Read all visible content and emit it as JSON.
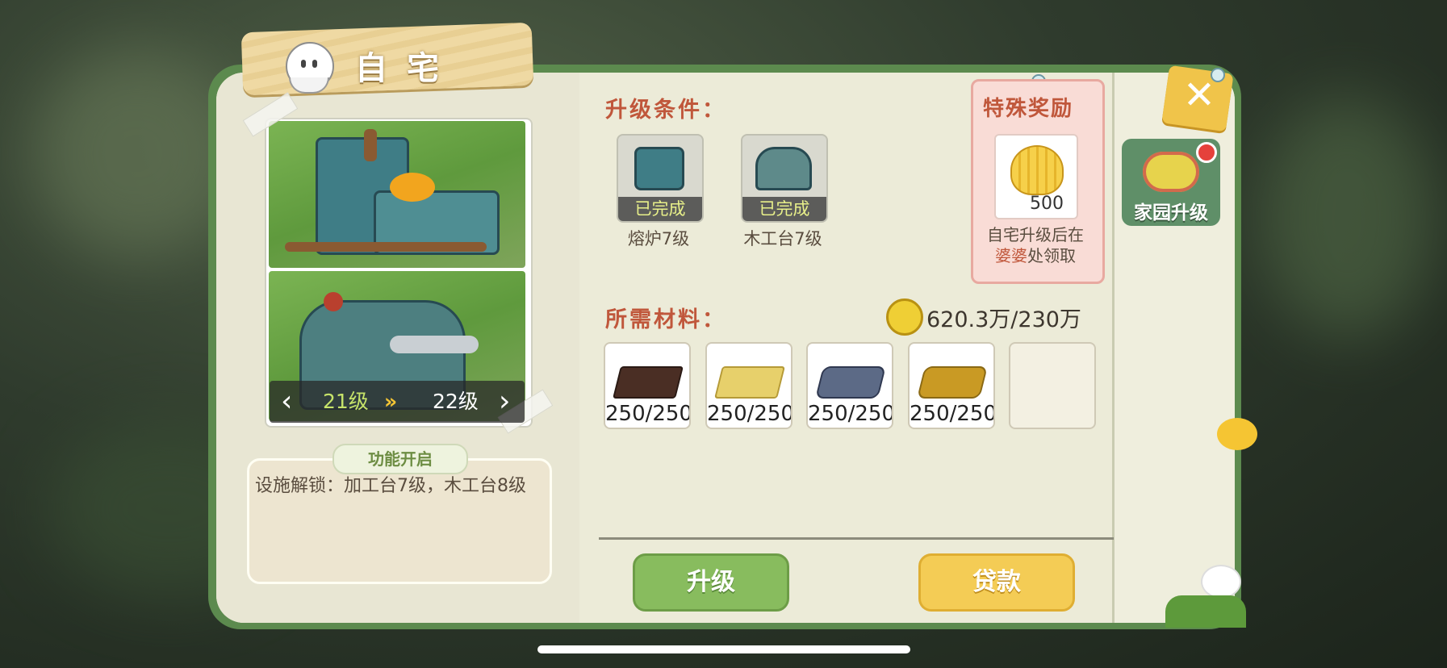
{
  "window": {
    "title": "自宅"
  },
  "building": {
    "current_level": "21级",
    "next_level": "22级"
  },
  "function_unlock": {
    "tag": "功能开启",
    "text": "设施解锁：加工台7级，木工台8级"
  },
  "upgrade_conditions": {
    "title": "升级条件：",
    "items": [
      {
        "label": "熔炉7级",
        "status": "已完成"
      },
      {
        "label": "木工台7级",
        "status": "已完成"
      }
    ]
  },
  "special_reward": {
    "title": "特殊奖励",
    "count": "500",
    "note_prefix": "自宅升级后在",
    "note_highlight": "婆婆",
    "note_suffix": "处领取"
  },
  "materials": {
    "title": "所需材料：",
    "coins": "620.3万/230万",
    "items": [
      {
        "name": "wood-plank",
        "count": "250/250",
        "color": "#4a2e24"
      },
      {
        "name": "light-wood",
        "count": "250/250",
        "color": "#e7d06b"
      },
      {
        "name": "iron-ingot",
        "count": "250/250",
        "color": "#5c6a86"
      },
      {
        "name": "gold-ingot",
        "count": "250/250",
        "color": "#c99a24"
      }
    ]
  },
  "buttons": {
    "upgrade": "升级",
    "loan": "贷款"
  },
  "side": {
    "home_upgrade": "家园升级"
  },
  "colors": {
    "accent_red": "#c0573b",
    "panel_green": "#5c8a4e",
    "button_green": "#88bc5e",
    "button_yellow": "#f4cc55"
  },
  "icons": {
    "close": "close-icon",
    "coin": "coin-icon",
    "shell": "golden-shell-icon"
  }
}
